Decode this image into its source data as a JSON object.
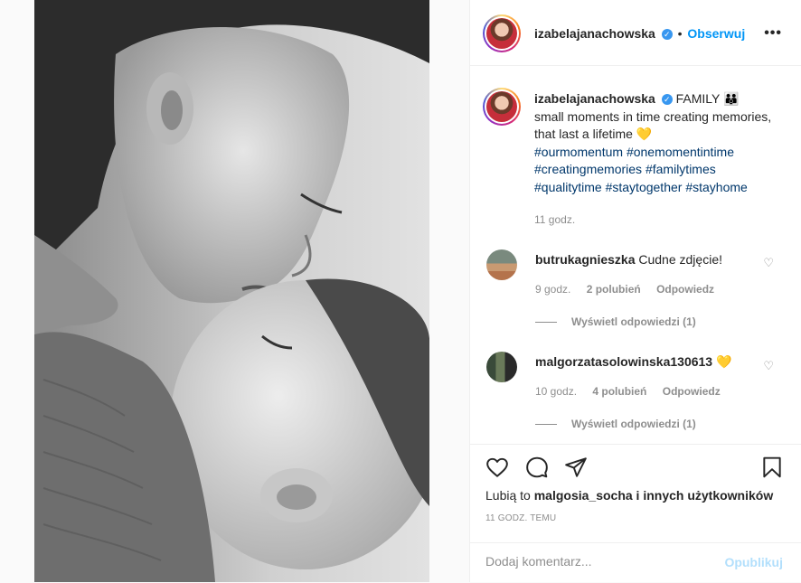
{
  "post": {
    "username": "izabelajanachowska",
    "dot": "•",
    "follow_label": "Obserwuj",
    "more_label": "•••",
    "caption": {
      "title": "FAMILY",
      "title_emoji": "👪",
      "line": "small moments in time creating memories, that last a lifetime",
      "line_emoji": "💛",
      "hashtags": [
        "#ourmomentum",
        "#onemomentintime",
        "#creatingmemories",
        "#familytimes",
        "#qualitytime",
        "#staytogether",
        "#stayhome"
      ],
      "time": "11 godz."
    }
  },
  "comments": [
    {
      "username": "butrukagnieszka",
      "text": "Cudne zdjęcie!",
      "time": "9 godz.",
      "likes": "2 polubień",
      "reply": "Odpowiedz",
      "view_replies": "Wyświetl odpowiedzi (1)"
    },
    {
      "username": "malgorzatasolowinska130613",
      "text": "💛",
      "time": "10 godz.",
      "likes": "4 polubień",
      "reply": "Odpowiedz",
      "view_replies": "Wyświetl odpowiedzi (1)"
    }
  ],
  "likes_summary": {
    "prefix": "Lubią to",
    "user": "malgosia_socha",
    "suffix": "i innych użytkowników"
  },
  "date": "11 GODZ. TEMU",
  "comment_box": {
    "placeholder": "Dodaj komentarz...",
    "publish_label": "Opublikuj"
  },
  "colors": {
    "link_blue": "#0095f6",
    "hashtag_blue": "#00376b",
    "muted": "#8e8e8e",
    "publish_disabled": "#b2dffc",
    "heart_emoji": "#f5b82e"
  },
  "icons": {
    "like": "heart-icon",
    "comment": "comment-icon",
    "share": "paper-plane-icon",
    "save": "bookmark-icon",
    "verified": "verified-badge-icon"
  }
}
